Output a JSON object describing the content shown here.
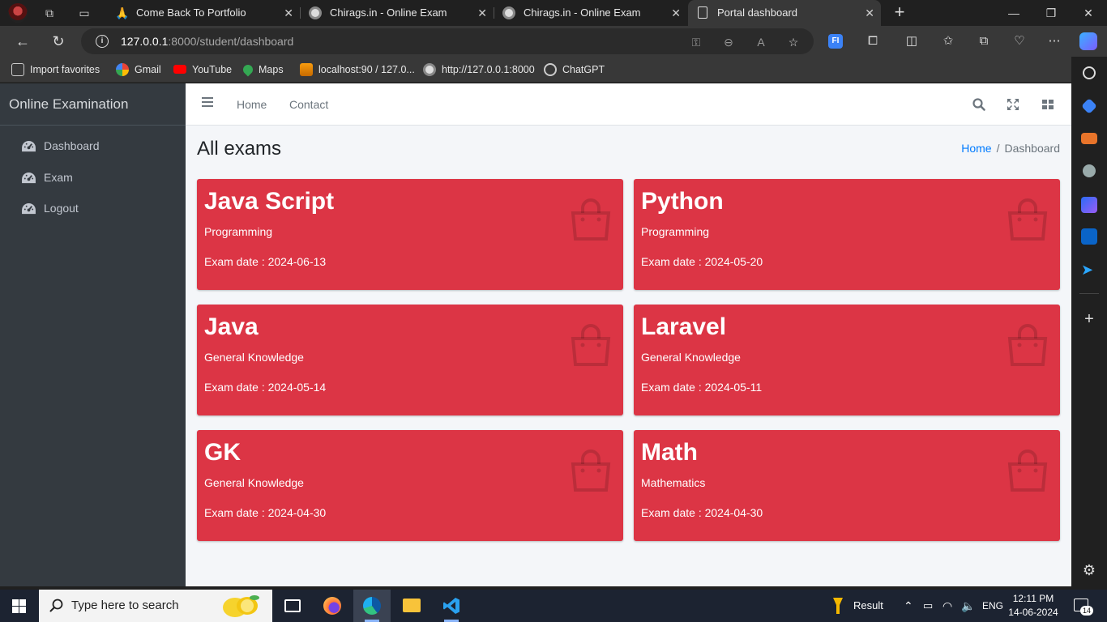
{
  "browser": {
    "tabs": [
      {
        "title": "Come Back To Portfolio",
        "active": false
      },
      {
        "title": "Chirags.in - Online Exam",
        "active": false
      },
      {
        "title": "Chirags.in - Online Exam",
        "active": false
      },
      {
        "title": "Portal dashboard",
        "active": true
      }
    ],
    "url_host": "127.0.0.1",
    "url_path": ":8000/student/dashboard",
    "favorites": [
      {
        "label": "Import favorites",
        "icon": "import-icon"
      },
      {
        "label": "Gmail",
        "icon": "google-icon"
      },
      {
        "label": "YouTube",
        "icon": "youtube-icon"
      },
      {
        "label": "Maps",
        "icon": "maps-icon"
      },
      {
        "label": "localhost:90 / 127.0...",
        "icon": "phpmyadmin-icon"
      },
      {
        "label": "http://127.0.0.1:8000",
        "icon": "globe-icon"
      },
      {
        "label": "ChatGPT",
        "icon": "chatgpt-icon"
      }
    ]
  },
  "app": {
    "brand": "Online Examination",
    "sidebar": [
      {
        "label": "Dashboard",
        "icon": "dashboard-dial-icon"
      },
      {
        "label": "Exam",
        "icon": "dashboard-dial-icon"
      },
      {
        "label": "Logout",
        "icon": "dashboard-dial-icon"
      }
    ],
    "topnav": {
      "home": "Home",
      "contact": "Contact"
    },
    "page_title": "All exams",
    "breadcrumb": {
      "home": "Home",
      "current": "Dashboard"
    },
    "date_label": "Exam date : ",
    "exams": [
      {
        "name": "Java Script",
        "category": "Programming",
        "date": "2024-06-13"
      },
      {
        "name": "Python",
        "category": "Programming",
        "date": "2024-05-20"
      },
      {
        "name": "Java",
        "category": "General Knowledge",
        "date": "2024-05-14"
      },
      {
        "name": "Laravel",
        "category": "General Knowledge",
        "date": "2024-05-11"
      },
      {
        "name": "GK",
        "category": "General Knowledge",
        "date": "2024-04-30"
      },
      {
        "name": "Math",
        "category": "Mathematics",
        "date": "2024-04-30"
      }
    ],
    "card_color": "#dc3545"
  },
  "taskbar": {
    "search_placeholder": "Type here to search",
    "weather_label": "Result",
    "lang": "ENG",
    "time": "12:11 PM",
    "date": "14-06-2024",
    "notifications": "14"
  }
}
